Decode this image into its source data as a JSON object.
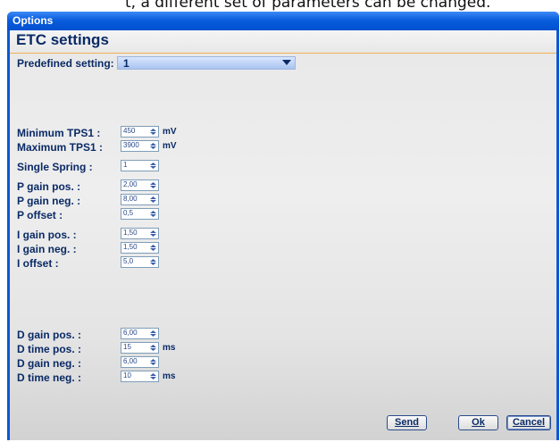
{
  "caption": "t, a different set of parameters can be changed.",
  "window": {
    "title": "Options"
  },
  "header": {
    "title": "ETC settings"
  },
  "predefined": {
    "label": "Predefined setting:",
    "value": "1"
  },
  "fields": {
    "min_tps1": {
      "label": "Minimum TPS1 :",
      "value": "450",
      "unit": "mV"
    },
    "max_tps1": {
      "label": "Maximum TPS1 :",
      "value": "3900",
      "unit": "mV"
    },
    "single_spring": {
      "label": "Single Spring :",
      "value": "1"
    },
    "p_gain_pos": {
      "label": "P gain pos. :",
      "value": "2,00"
    },
    "p_gain_neg": {
      "label": "P gain neg. :",
      "value": "8,00"
    },
    "p_offset": {
      "label": "P offset :",
      "value": "0,5"
    },
    "i_gain_pos": {
      "label": "I gain pos. :",
      "value": "1,50"
    },
    "i_gain_neg": {
      "label": "I gain neg. :",
      "value": "1,50"
    },
    "i_offset": {
      "label": "I offset :",
      "value": "5,0"
    },
    "d_gain_pos": {
      "label": "D gain pos. :",
      "value": "6,00"
    },
    "d_time_pos": {
      "label": "D time pos. :",
      "value": "15",
      "unit": "ms"
    },
    "d_gain_neg": {
      "label": "D gain neg. :",
      "value": "6,00"
    },
    "d_time_neg": {
      "label": "D time neg. :",
      "value": "10",
      "unit": "ms"
    }
  },
  "buttons": {
    "send": "Send",
    "ok": "Ok",
    "cancel": "Cancel"
  }
}
